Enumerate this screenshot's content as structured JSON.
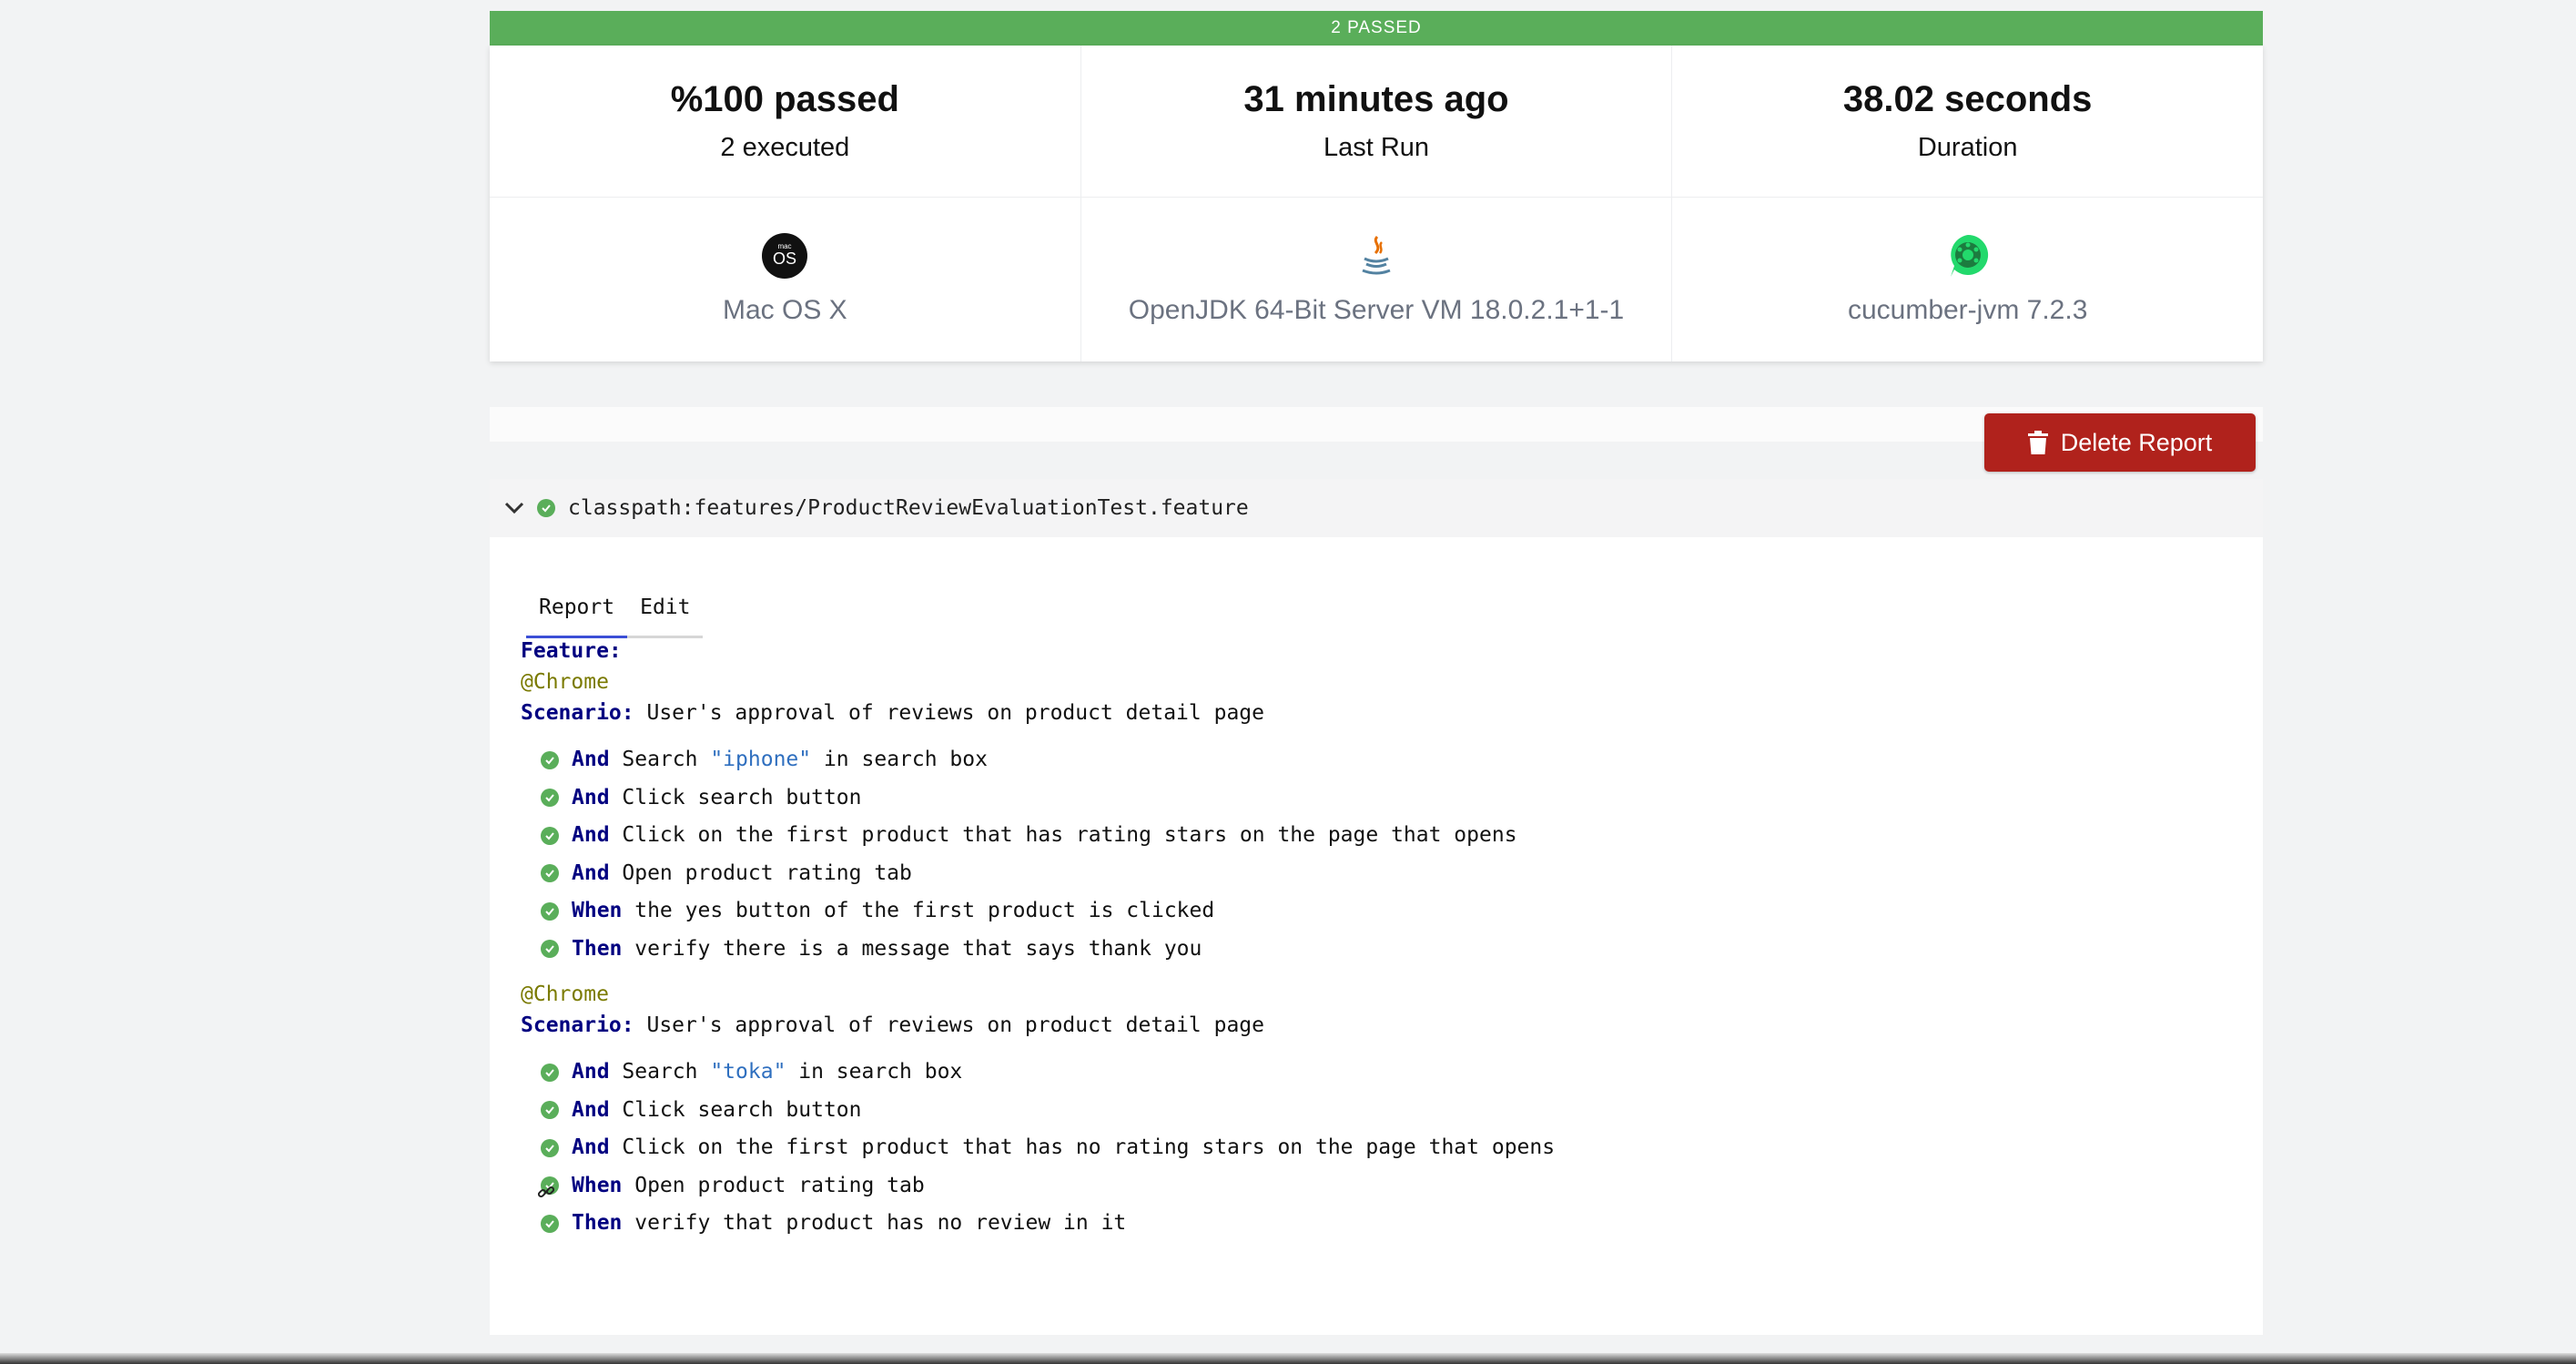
{
  "summary": {
    "banner": "2 PASSED",
    "passed": "%100 passed",
    "executed": "2 executed",
    "last_run_value": "31 minutes ago",
    "last_run_label": "Last Run",
    "duration_value": "38.02 seconds",
    "duration_label": "Duration"
  },
  "environment": {
    "os": {
      "label": "Mac OS X",
      "icon": "macos-icon"
    },
    "jvm": {
      "label": "OpenJDK 64-Bit Server VM 18.0.2.1+1-1",
      "icon": "java-icon"
    },
    "framework": {
      "label": "cucumber-jvm 7.2.3",
      "icon": "cucumber-icon"
    }
  },
  "actions": {
    "delete_report": "Delete Report"
  },
  "feature": {
    "path": "classpath:features/ProductReviewEvaluationTest.feature",
    "tabs": [
      {
        "label": "Report"
      },
      {
        "label": "Edit"
      }
    ],
    "feature_keyword": "Feature:",
    "scenarios": [
      {
        "tag": "@Chrome",
        "keyword": "Scenario:",
        "name": " User's approval of reviews on product detail page",
        "steps": [
          {
            "kw": "And",
            "pre": " Search ",
            "str": "\"iphone\"",
            "post": " in search box"
          },
          {
            "kw": "And",
            "pre": " Click search button",
            "str": "",
            "post": ""
          },
          {
            "kw": "And",
            "pre": " Click on the first product that has rating stars on the page that opens",
            "str": "",
            "post": ""
          },
          {
            "kw": "And",
            "pre": " Open product rating tab",
            "str": "",
            "post": ""
          },
          {
            "kw": "When",
            "pre": " the yes button of the first product is clicked",
            "str": "",
            "post": ""
          },
          {
            "kw": "Then",
            "pre": " verify there is a message that says thank you",
            "str": "",
            "post": ""
          }
        ]
      },
      {
        "tag": "@Chrome",
        "keyword": "Scenario:",
        "name": " User's approval of reviews on product detail page",
        "steps": [
          {
            "kw": "And",
            "pre": " Search ",
            "str": "\"toka\"",
            "post": " in search box"
          },
          {
            "kw": "And",
            "pre": " Click search button",
            "str": "",
            "post": ""
          },
          {
            "kw": "And",
            "pre": " Click on the first product that has no rating stars on the page that opens",
            "str": "",
            "post": ""
          },
          {
            "kw": "When",
            "pre": " Open product rating tab",
            "str": "",
            "post": ""
          },
          {
            "kw": "Then",
            "pre": " verify that product has no review in it",
            "str": "",
            "post": ""
          }
        ]
      }
    ]
  },
  "colors": {
    "passed": "#5aae5a",
    "danger": "#b0221c",
    "keyword": "#000080",
    "tag": "#7a7a00",
    "string": "#2f6fbf"
  }
}
